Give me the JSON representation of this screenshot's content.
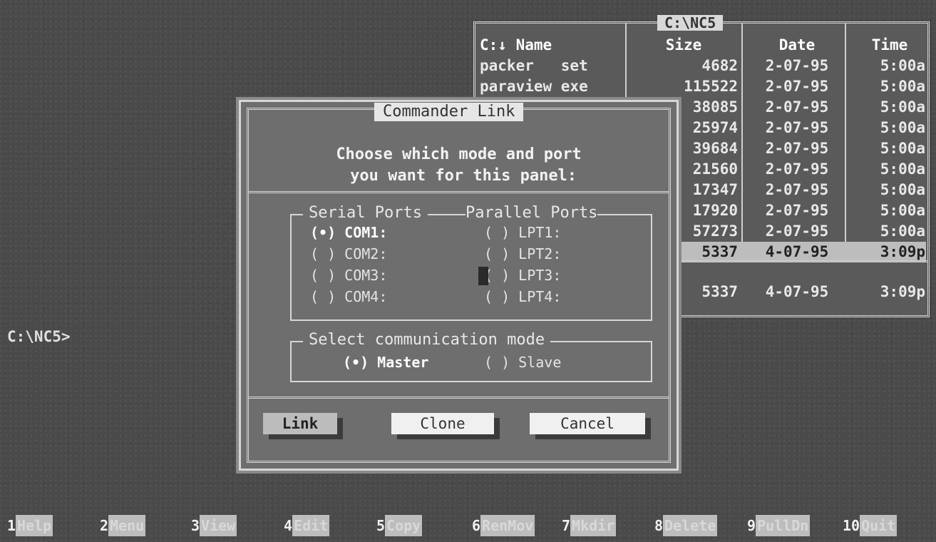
{
  "panel": {
    "title": "C:\\NC5",
    "headers": {
      "name": "C:↓ Name",
      "size": "Size",
      "date": "Date",
      "time": "Time"
    },
    "rows": [
      {
        "name": "packer   set",
        "size": "4682",
        "date": "2-07-95",
        "time": "5:00a"
      },
      {
        "name": "paraview exe",
        "size": "115522",
        "date": "2-07-95",
        "time": "5:00a"
      },
      {
        "name": "",
        "size": "38085",
        "date": "2-07-95",
        "time": "5:00a"
      },
      {
        "name": "",
        "size": "25974",
        "date": "2-07-95",
        "time": "5:00a"
      },
      {
        "name": "",
        "size": "39684",
        "date": "2-07-95",
        "time": "5:00a"
      },
      {
        "name": "",
        "size": "21560",
        "date": "2-07-95",
        "time": "5:00a"
      },
      {
        "name": "",
        "size": "17347",
        "date": "2-07-95",
        "time": "5:00a"
      },
      {
        "name": "",
        "size": "17920",
        "date": "2-07-95",
        "time": "5:00a"
      },
      {
        "name": "",
        "size": "57273",
        "date": "2-07-95",
        "time": "5:00a"
      },
      {
        "name": "",
        "size": "5337",
        "date": "4-07-95",
        "time": "3:09p"
      }
    ],
    "footer": {
      "size": "5337",
      "date": "4-07-95",
      "time": "3:09p"
    }
  },
  "prompt": "C:\\NC5>",
  "dialog": {
    "title": "Commander Link",
    "prompt": "Choose which mode and port\n you want for this panel:",
    "serial_title": "Serial Ports",
    "parallel_title": "Parallel Ports",
    "serial_ports": [
      "(•) COM1:",
      "( ) COM2:",
      "( ) COM3:",
      "( ) COM4:"
    ],
    "parallel_ports": [
      "( ) LPT1:",
      "( ) LPT2:",
      "( ) LPT3:",
      "( ) LPT4:"
    ],
    "mode_title": "Select communication mode",
    "mode_master": "(•) Master",
    "mode_slave": "( ) Slave",
    "buttons": {
      "link": "Link",
      "clone": "Clone",
      "cancel": "Cancel"
    }
  },
  "fkeys": [
    {
      "num": "1",
      "label": "Help"
    },
    {
      "num": "2",
      "label": "Menu"
    },
    {
      "num": "3",
      "label": "View"
    },
    {
      "num": "4",
      "label": "Edit"
    },
    {
      "num": "5",
      "label": "Copy"
    },
    {
      "num": "6",
      "label": "RenMov"
    },
    {
      "num": "7",
      "label": "Mkdir"
    },
    {
      "num": "8",
      "label": "Delete"
    },
    {
      "num": "9",
      "label": "PullDn"
    },
    {
      "num": "10",
      "label": "Quit"
    }
  ]
}
